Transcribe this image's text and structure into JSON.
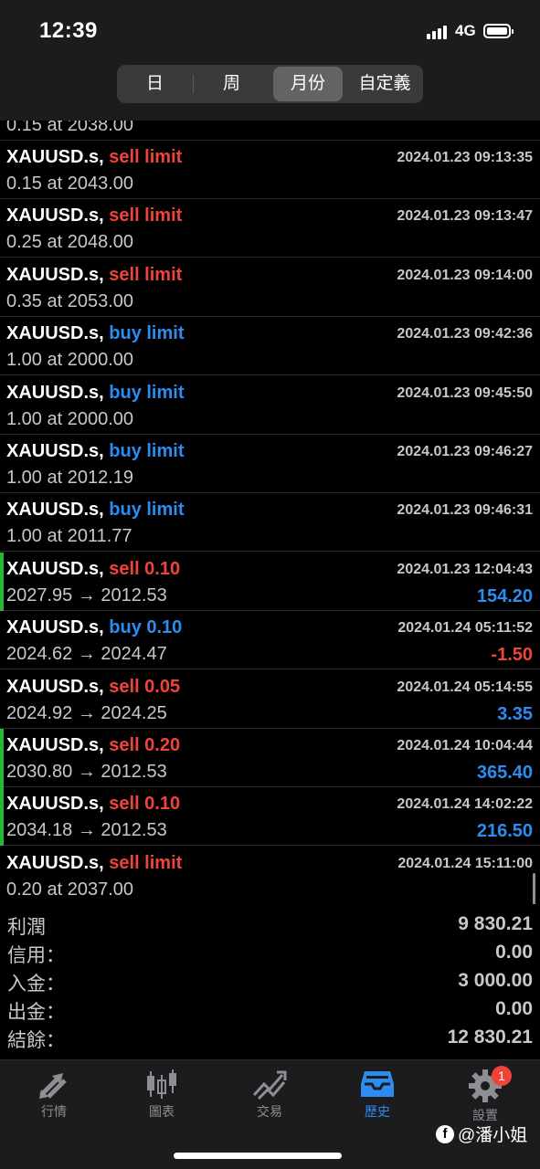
{
  "status_bar": {
    "time": "12:39",
    "network": "4G"
  },
  "period_tabs": [
    {
      "label": "日",
      "active": false
    },
    {
      "label": "周",
      "active": false
    },
    {
      "label": "月份",
      "active": true
    },
    {
      "label": "自定義",
      "active": false
    }
  ],
  "partial_row": {
    "line2": "0.15 at 2038.00"
  },
  "orders": [
    {
      "symbol": "XAUUSD.s,",
      "action": "sell limit",
      "side": "sell",
      "time": "2024.01.23 09:13:35",
      "detail": "0.15 at 2043.00",
      "pl": "",
      "closed": false
    },
    {
      "symbol": "XAUUSD.s,",
      "action": "sell limit",
      "side": "sell",
      "time": "2024.01.23 09:13:47",
      "detail": "0.25 at 2048.00",
      "pl": "",
      "closed": false
    },
    {
      "symbol": "XAUUSD.s,",
      "action": "sell limit",
      "side": "sell",
      "time": "2024.01.23 09:14:00",
      "detail": "0.35 at 2053.00",
      "pl": "",
      "closed": false
    },
    {
      "symbol": "XAUUSD.s,",
      "action": "buy limit",
      "side": "buy",
      "time": "2024.01.23 09:42:36",
      "detail": "1.00 at 2000.00",
      "pl": "",
      "closed": false
    },
    {
      "symbol": "XAUUSD.s,",
      "action": "buy limit",
      "side": "buy",
      "time": "2024.01.23 09:45:50",
      "detail": "1.00 at 2000.00",
      "pl": "",
      "closed": false
    },
    {
      "symbol": "XAUUSD.s,",
      "action": "buy limit",
      "side": "buy",
      "time": "2024.01.23 09:46:27",
      "detail": "1.00 at 2012.19",
      "pl": "",
      "closed": false
    },
    {
      "symbol": "XAUUSD.s,",
      "action": "buy limit",
      "side": "buy",
      "time": "2024.01.23 09:46:31",
      "detail": "1.00 at 2011.77",
      "pl": "",
      "closed": false
    },
    {
      "symbol": "XAUUSD.s,",
      "action": "sell 0.10",
      "side": "sell",
      "time": "2024.01.23 12:04:43",
      "detail": "2027.95 → 2012.53",
      "pl": "154.20",
      "pl_sign": "pos",
      "closed": true,
      "accent": true
    },
    {
      "symbol": "XAUUSD.s,",
      "action": "buy 0.10",
      "side": "buy",
      "time": "2024.01.24 05:11:52",
      "detail": "2024.62 → 2024.47",
      "pl": "-1.50",
      "pl_sign": "neg",
      "closed": true,
      "accent": false
    },
    {
      "symbol": "XAUUSD.s,",
      "action": "sell 0.05",
      "side": "sell",
      "time": "2024.01.24 05:14:55",
      "detail": "2024.92 → 2024.25",
      "pl": "3.35",
      "pl_sign": "pos",
      "closed": true,
      "accent": false
    },
    {
      "symbol": "XAUUSD.s,",
      "action": "sell 0.20",
      "side": "sell",
      "time": "2024.01.24 10:04:44",
      "detail": "2030.80 → 2012.53",
      "pl": "365.40",
      "pl_sign": "pos",
      "closed": true,
      "accent": true
    },
    {
      "symbol": "XAUUSD.s,",
      "action": "sell 0.10",
      "side": "sell",
      "time": "2024.01.24 14:02:22",
      "detail": "2034.18 → 2012.53",
      "pl": "216.50",
      "pl_sign": "pos",
      "closed": true,
      "accent": true
    },
    {
      "symbol": "XAUUSD.s,",
      "action": "sell limit",
      "side": "sell",
      "time": "2024.01.24 15:11:00",
      "detail": "0.20 at 2037.00",
      "pl": "",
      "closed": false
    }
  ],
  "summary": [
    {
      "label": "利潤",
      "value": "9 830.21"
    },
    {
      "label": "信用：",
      "value": "0.00"
    },
    {
      "label": "入金：",
      "value": "3 000.00"
    },
    {
      "label": "出金：",
      "value": "0.00"
    },
    {
      "label": "結餘：",
      "value": "12 830.21"
    }
  ],
  "nav": [
    {
      "label": "行情",
      "icon": "quotes-arrows-icon",
      "active": false
    },
    {
      "label": "圖表",
      "icon": "candlestick-chart-icon",
      "active": false
    },
    {
      "label": "交易",
      "icon": "trade-trend-icon",
      "active": false
    },
    {
      "label": "歷史",
      "icon": "history-inbox-icon",
      "active": true
    },
    {
      "label": "設置",
      "icon": "gear-icon",
      "active": false,
      "badge": "1"
    }
  ],
  "watermark": "@潘小姐",
  "colors": {
    "sell": "#f0433a",
    "buy": "#2c8cf0",
    "profit": "#2c8cf0",
    "loss": "#f0433a",
    "accent_bar": "#27b83a"
  }
}
